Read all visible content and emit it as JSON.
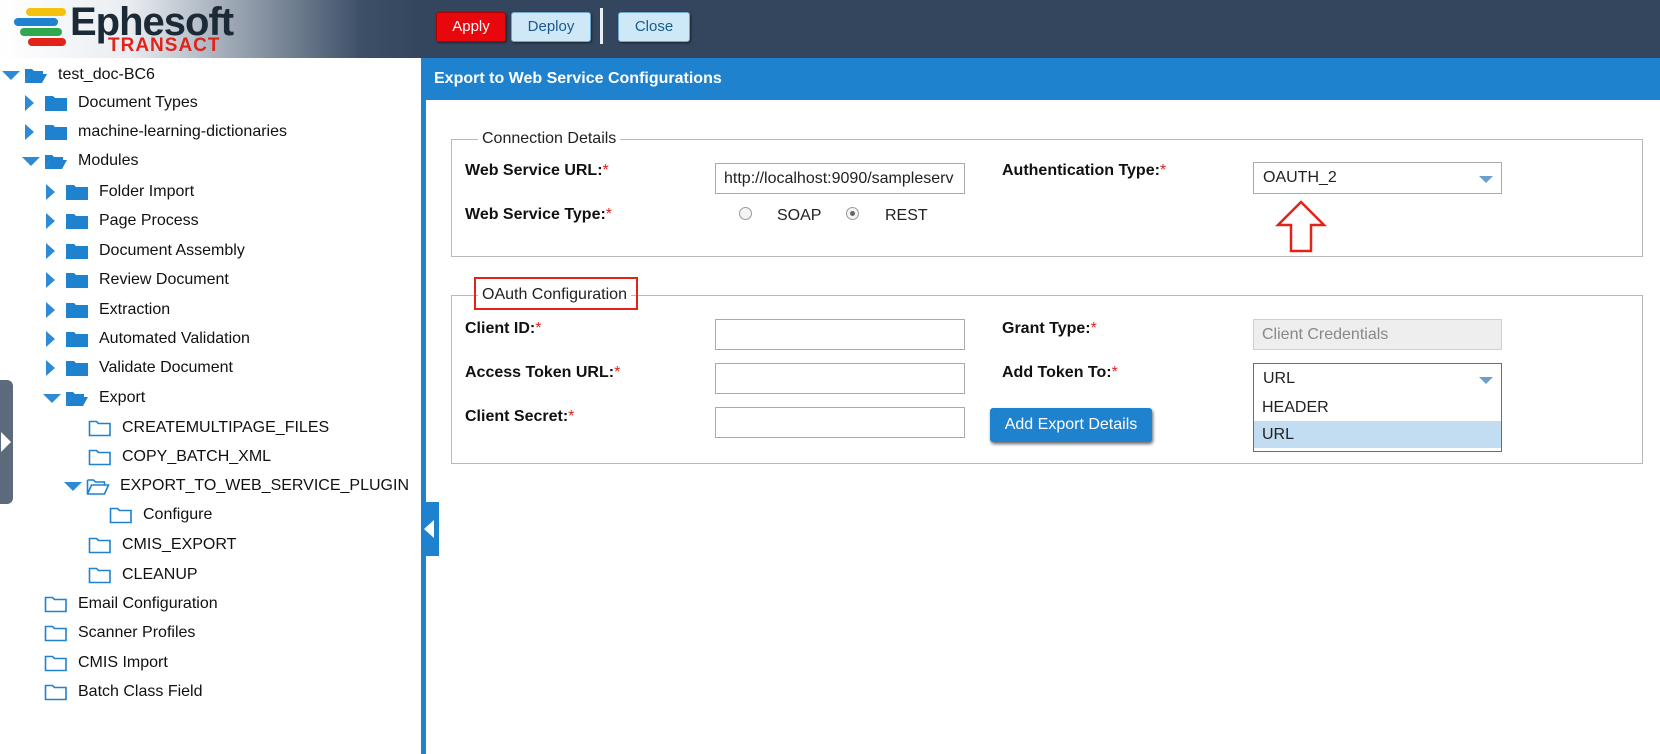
{
  "header": {
    "logo_text": "Ephesoft",
    "logo_subtext": "TRANSACT",
    "apply_label": "Apply",
    "deploy_label": "Deploy",
    "close_label": "Close"
  },
  "tree": {
    "root": "test_doc-BC6",
    "items": [
      {
        "label": "Document Types"
      },
      {
        "label": "machine-learning-dictionaries"
      },
      {
        "label": "Modules"
      },
      {
        "label": "Folder Import"
      },
      {
        "label": "Page Process"
      },
      {
        "label": "Document Assembly"
      },
      {
        "label": "Review Document"
      },
      {
        "label": "Extraction"
      },
      {
        "label": "Automated Validation"
      },
      {
        "label": "Validate Document"
      },
      {
        "label": "Export"
      },
      {
        "label": "CREATEMULTIPAGE_FILES"
      },
      {
        "label": "COPY_BATCH_XML"
      },
      {
        "label": "EXPORT_TO_WEB_SERVICE_PLUGIN"
      },
      {
        "label": "Configure"
      },
      {
        "label": "CMIS_EXPORT"
      },
      {
        "label": "CLEANUP"
      },
      {
        "label": "Email Configuration"
      },
      {
        "label": "Scanner Profiles"
      },
      {
        "label": "CMIS Import"
      },
      {
        "label": "Batch Class Field"
      }
    ]
  },
  "panel": {
    "title": "Export to Web Service Configurations",
    "connection": {
      "legend": "Connection Details",
      "url_label": "Web Service URL:",
      "url_value": "http://localhost:9090/sampleserv",
      "type_label": "Web Service Type:",
      "type_options": [
        "SOAP",
        "REST"
      ],
      "type_selected": "REST",
      "auth_label": "Authentication Type:",
      "auth_value": "OAUTH_2",
      "required_mark": "*"
    },
    "oauth": {
      "legend": "OAuth Configuration",
      "client_id_label": "Client ID:",
      "client_id_value": "",
      "token_url_label": "Access Token URL:",
      "token_url_value": "",
      "secret_label": "Client Secret:",
      "secret_value": "",
      "grant_label": "Grant Type:",
      "grant_value": "Client Credentials",
      "add_token_label": "Add Token To:",
      "add_token_value": "URL",
      "add_token_options": [
        "HEADER",
        "URL"
      ],
      "add_button": "Add Export Details"
    }
  },
  "colors": {
    "accent": "#1f82cf",
    "apply": "#e8070c",
    "annotation": "#e2231a"
  }
}
